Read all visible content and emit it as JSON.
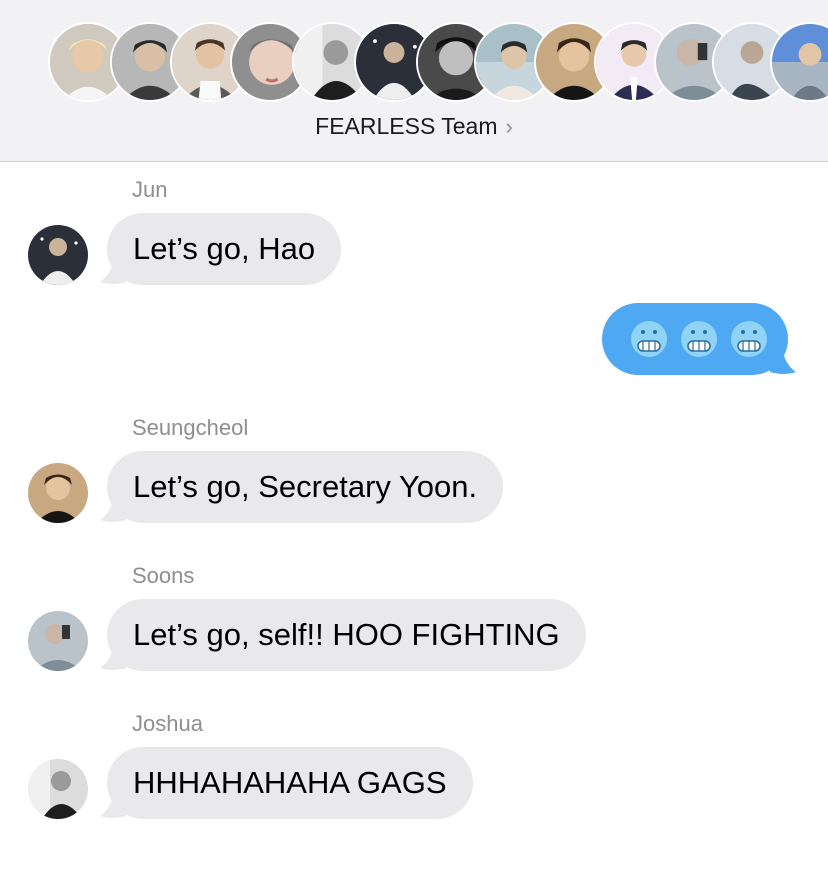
{
  "conversation": {
    "group_name": "FEARLESS Team",
    "chevron": "›",
    "participant_avatar_count": 13
  },
  "messages": [
    {
      "sender": "Jun",
      "text": "Let’s go, Hao"
    },
    {
      "sender": "You",
      "text": "🥶🥶🥶"
    },
    {
      "sender": "Seungcheol",
      "text": "Let’s go, Secretary Yoon."
    },
    {
      "sender": "Soons",
      "text": "Let’s go, self!! HOO FIGHTING"
    },
    {
      "sender": "Joshua",
      "text": "HHHAHAHAHA GAGS"
    }
  ],
  "colors": {
    "received_bubble": "#e9e9eb",
    "sent_bubble": "#4ea8f2",
    "header_bg": "#f2f2f4",
    "secondary_text": "#8e8e93"
  }
}
